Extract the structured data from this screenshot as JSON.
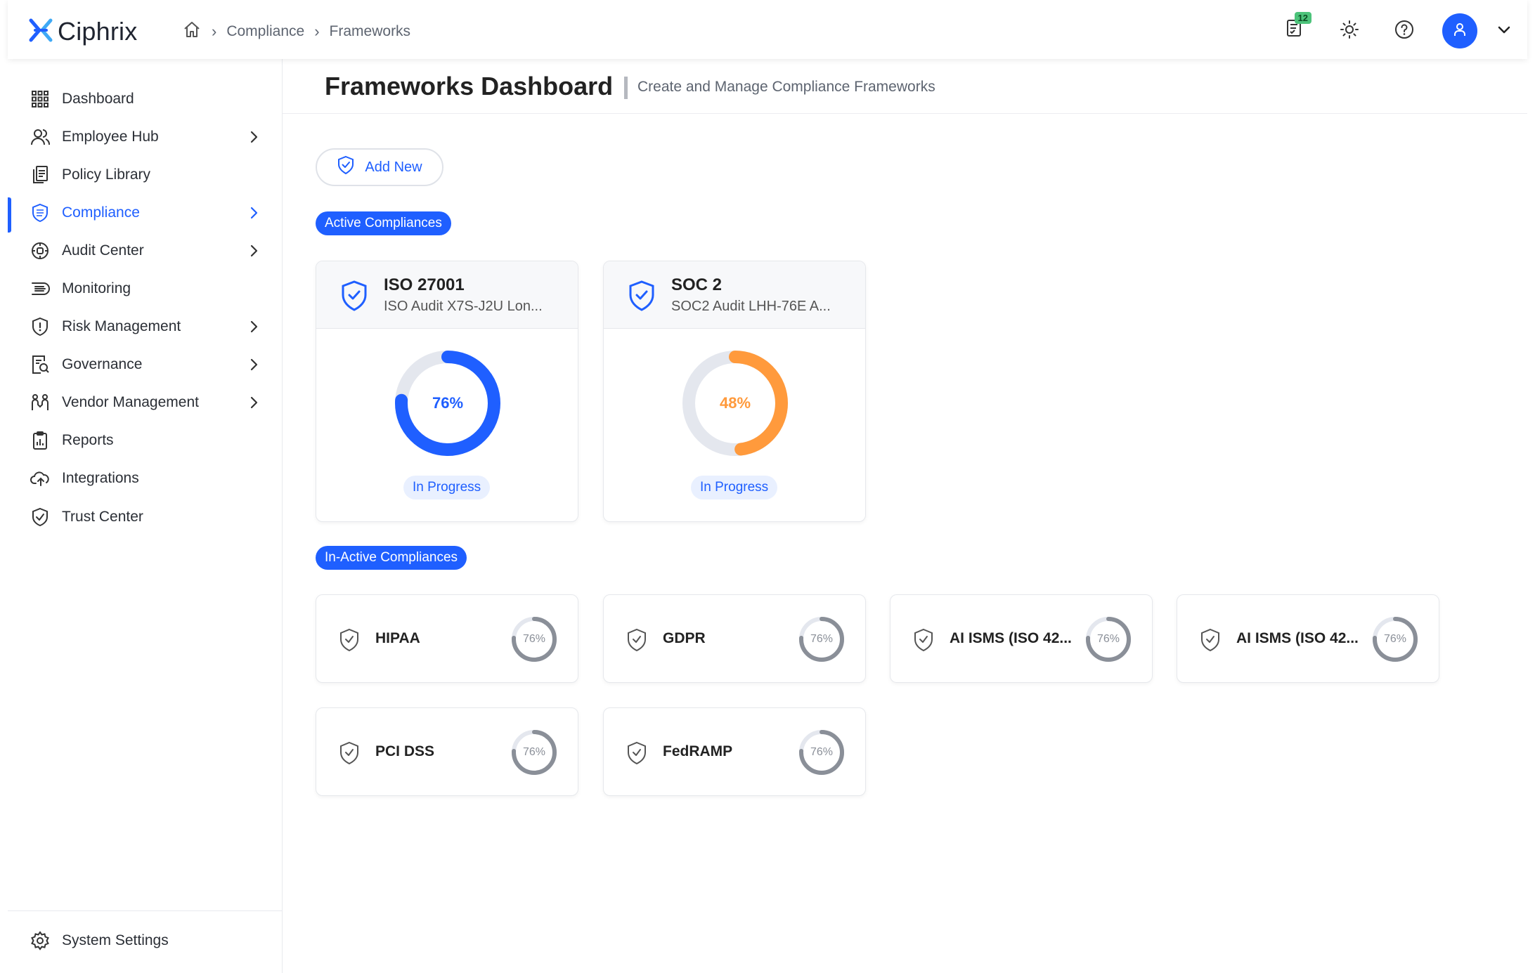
{
  "app": {
    "name": "Ciphrix"
  },
  "breadcrumb": [
    "Compliance",
    "Frameworks"
  ],
  "topbar": {
    "notification_count": "12"
  },
  "sidebar": {
    "items": [
      {
        "label": "Dashboard",
        "icon": "grid-icon",
        "has_children": false,
        "active": false
      },
      {
        "label": "Employee Hub",
        "icon": "users-icon",
        "has_children": true,
        "active": false
      },
      {
        "label": "Policy Library",
        "icon": "documents-icon",
        "has_children": false,
        "active": false
      },
      {
        "label": "Compliance",
        "icon": "shield-icon",
        "has_children": true,
        "active": true
      },
      {
        "label": "Audit Center",
        "icon": "audit-icon",
        "has_children": true,
        "active": false
      },
      {
        "label": "Monitoring",
        "icon": "monitoring-icon",
        "has_children": false,
        "active": false
      },
      {
        "label": "Risk Management",
        "icon": "risk-shield-icon",
        "has_children": true,
        "active": false
      },
      {
        "label": "Governance",
        "icon": "governance-icon",
        "has_children": true,
        "active": false
      },
      {
        "label": "Vendor Management",
        "icon": "vendor-icon",
        "has_children": true,
        "active": false
      },
      {
        "label": "Reports",
        "icon": "clipboard-icon",
        "has_children": false,
        "active": false
      },
      {
        "label": "Integrations",
        "icon": "cloud-icon",
        "has_children": false,
        "active": false
      },
      {
        "label": "Trust Center",
        "icon": "trust-shield-icon",
        "has_children": false,
        "active": false
      }
    ],
    "settings_label": "System Settings"
  },
  "page": {
    "title": "Frameworks Dashboard",
    "subtitle": "Create and Manage Compliance Frameworks",
    "add_button": "Add New"
  },
  "colors": {
    "accent": "#1f5fff",
    "warning": "#ff9a3c",
    "ring_track": "#e4e7ee",
    "ring_inactive": "#8a8f98"
  },
  "active_section": {
    "label": "Active Compliances",
    "cards": [
      {
        "title": "ISO 27001",
        "subtitle": "ISO Audit X7S-J2U Lon...",
        "progress": 76,
        "progress_label": "76%",
        "status": "In Progress",
        "color": "#1f5fff"
      },
      {
        "title": "SOC 2",
        "subtitle": "SOC2 Audit LHH-76E A...",
        "progress": 48,
        "progress_label": "48%",
        "status": "In Progress",
        "color": "#ff9a3c"
      }
    ]
  },
  "inactive_section": {
    "label": "In-Active Compliances",
    "cards": [
      {
        "name": "HIPAA",
        "progress": 76,
        "progress_label": "76%"
      },
      {
        "name": "GDPR",
        "progress": 76,
        "progress_label": "76%"
      },
      {
        "name": "AI ISMS (ISO 42...",
        "progress": 76,
        "progress_label": "76%"
      },
      {
        "name": "AI ISMS (ISO 42...",
        "progress": 76,
        "progress_label": "76%"
      },
      {
        "name": "PCI DSS",
        "progress": 76,
        "progress_label": "76%"
      },
      {
        "name": "FedRAMP",
        "progress": 76,
        "progress_label": "76%"
      }
    ]
  }
}
